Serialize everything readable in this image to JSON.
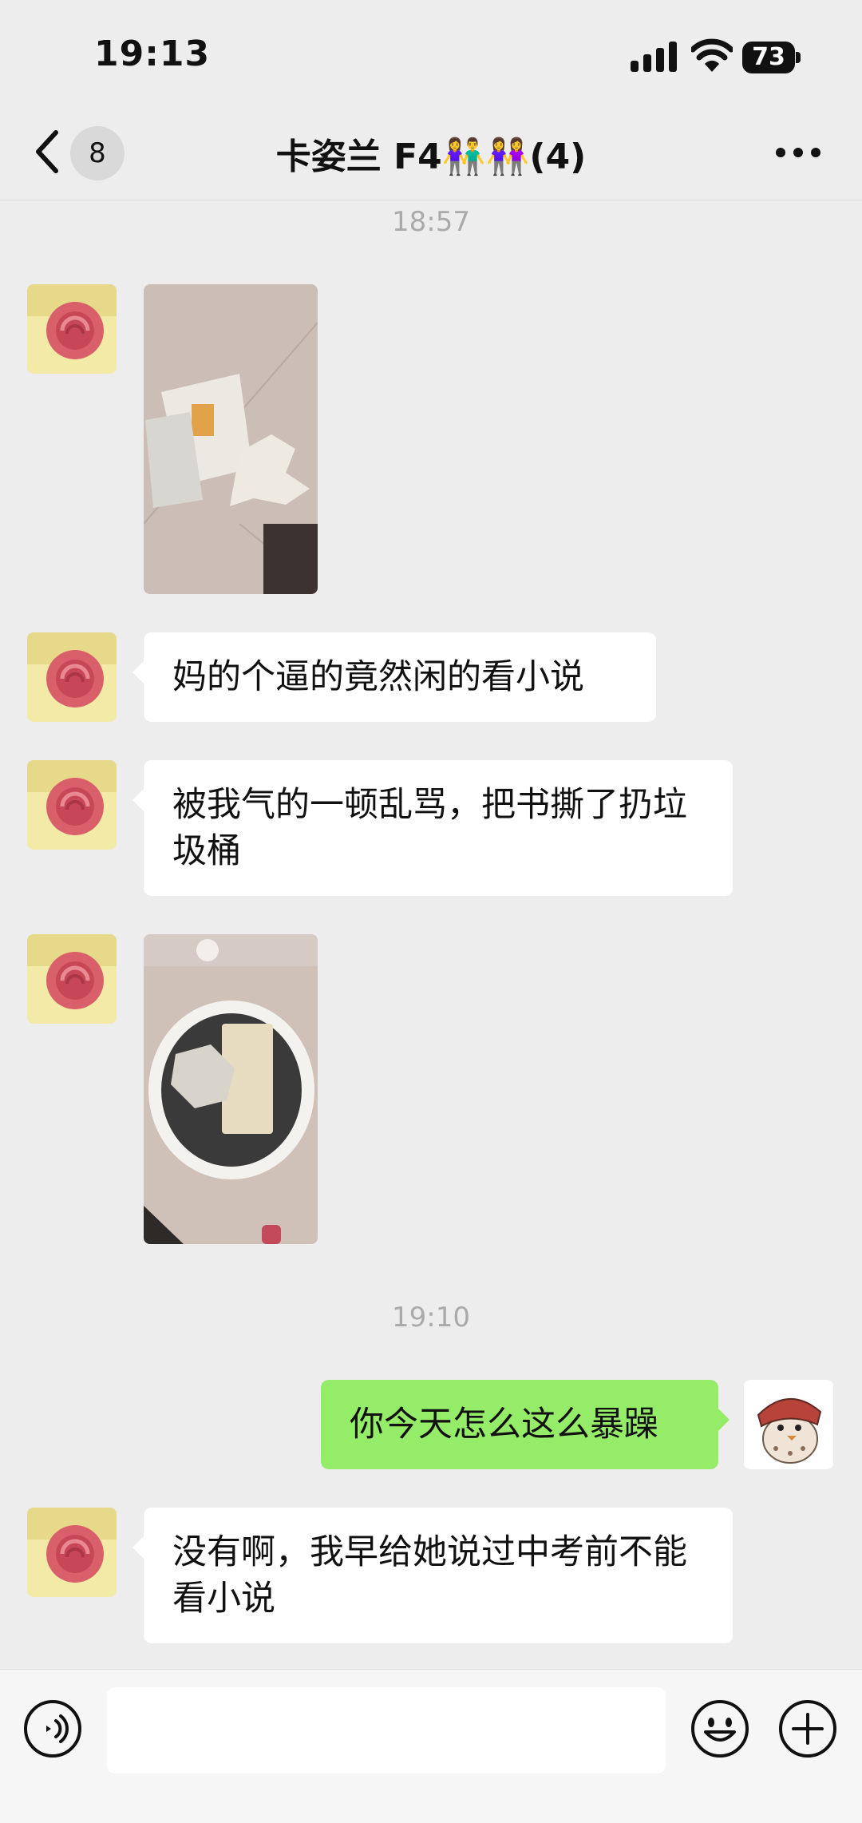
{
  "status_bar": {
    "time": "19:13",
    "battery": "73"
  },
  "nav": {
    "back_icon": "chevron-left-icon",
    "unread_count": "8",
    "title": "卡姿兰 F4👫👭(4)",
    "more_icon": "more-icon"
  },
  "timestamps": [
    "18:57",
    "19:10"
  ],
  "messages": [
    {
      "sender": "other",
      "type": "image",
      "content": "photo of torn book pages on floor"
    },
    {
      "sender": "other",
      "type": "text",
      "text": "妈的个逼的竟然闲的看小说"
    },
    {
      "sender": "other",
      "type": "text",
      "text": "被我气的一顿乱骂，把书撕了扔垃圾桶"
    },
    {
      "sender": "other",
      "type": "image",
      "content": "photo of book in trash bin"
    },
    {
      "sender": "self",
      "type": "text",
      "text": "你今天怎么这么暴躁"
    },
    {
      "sender": "other",
      "type": "text",
      "text": "没有啊，我早给她说过中考前不能看小说"
    }
  ],
  "input_bar": {
    "voice_icon": "voice-icon",
    "message_value": "",
    "emoji_icon": "emoji-icon",
    "plus_icon": "plus-icon"
  },
  "colors": {
    "self_bubble": "#95ec69",
    "other_bubble": "#ffffff",
    "background": "#ededed"
  }
}
